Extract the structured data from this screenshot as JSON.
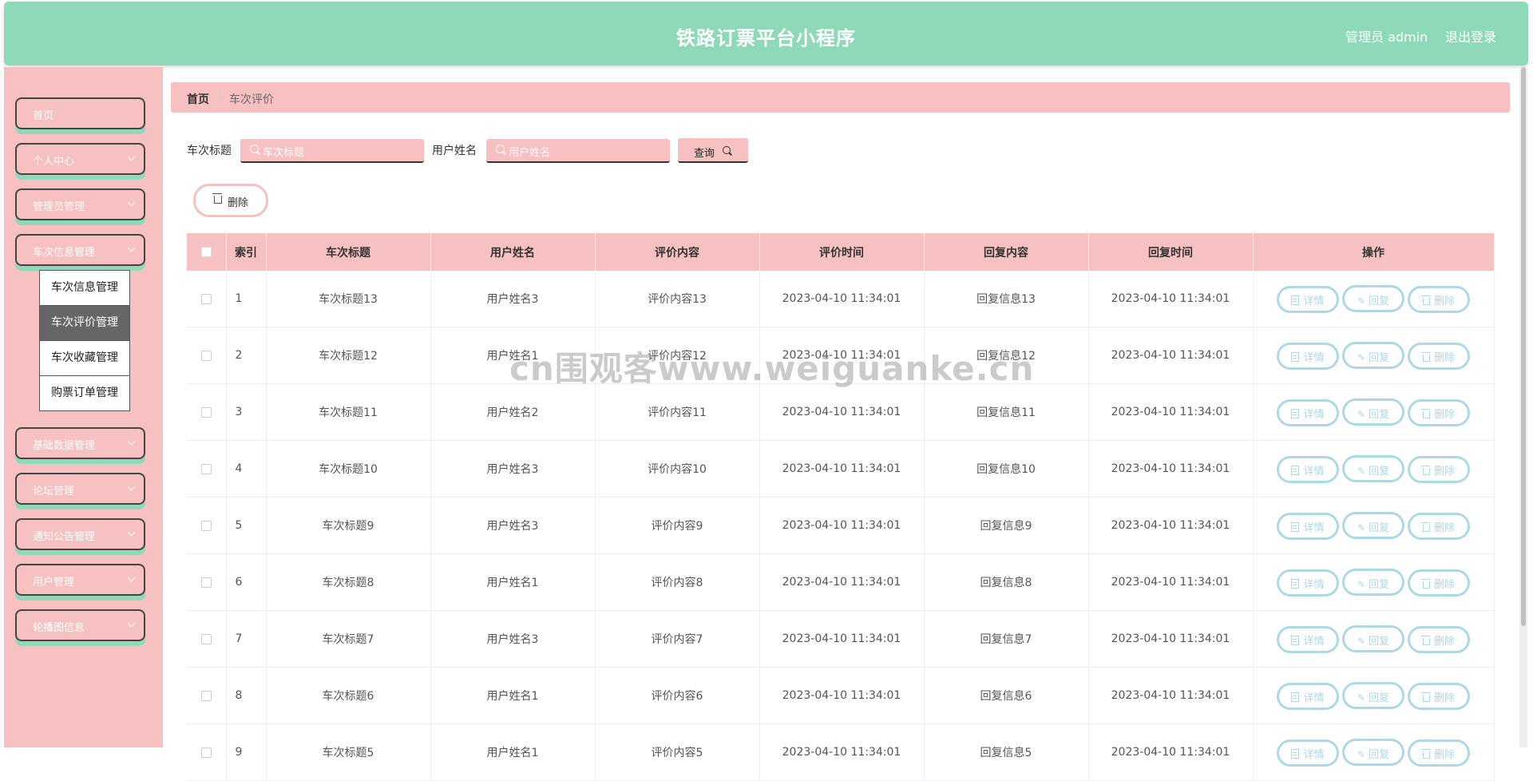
{
  "header": {
    "title": "铁路订票平台小程序",
    "admin_label": "管理员 admin",
    "logout_label": "退出登录"
  },
  "sidebar": {
    "items": [
      {
        "label": "首页",
        "has_chevron": false
      },
      {
        "label": "个人中心",
        "has_chevron": true
      },
      {
        "label": "管理员管理",
        "has_chevron": true
      },
      {
        "label": "车次信息管理",
        "has_chevron": true
      },
      {
        "label": "基础数据管理",
        "has_chevron": true
      },
      {
        "label": "论坛管理",
        "has_chevron": true
      },
      {
        "label": "通知公告管理",
        "has_chevron": true
      },
      {
        "label": "用户管理",
        "has_chevron": true
      },
      {
        "label": "轮播图信息",
        "has_chevron": true
      }
    ],
    "submenu": [
      "车次信息管理",
      "车次评价管理",
      "车次收藏管理",
      "购票订单管理"
    ],
    "active_submenu": "车次评价管理"
  },
  "breadcrumb": {
    "home": "首页",
    "separator": "/",
    "current": "车次评价"
  },
  "search": {
    "title_label": "车次标题",
    "title_placeholder": "车次标题",
    "user_label": "用户姓名",
    "user_placeholder": "用户姓名",
    "query_label": "查询"
  },
  "toolbar": {
    "delete_label": "删除"
  },
  "table": {
    "columns": [
      "索引",
      "车次标题",
      "用户姓名",
      "评价内容",
      "评价时间",
      "回复内容",
      "回复时间",
      "操作"
    ],
    "actions": [
      "详情",
      "回复",
      "删除"
    ],
    "rows": [
      [
        "1",
        "车次标题13",
        "用户姓名3",
        "评价内容13",
        "2023-04-10 11:34:01",
        "回复信息13",
        "2023-04-10 11:34:01"
      ],
      [
        "2",
        "车次标题12",
        "用户姓名1",
        "评价内容12",
        "2023-04-10 11:34:01",
        "回复信息12",
        "2023-04-10 11:34:01"
      ],
      [
        "3",
        "车次标题11",
        "用户姓名2",
        "评价内容11",
        "2023-04-10 11:34:01",
        "回复信息11",
        "2023-04-10 11:34:01"
      ],
      [
        "4",
        "车次标题10",
        "用户姓名3",
        "评价内容10",
        "2023-04-10 11:34:01",
        "回复信息10",
        "2023-04-10 11:34:01"
      ],
      [
        "5",
        "车次标题9",
        "用户姓名3",
        "评价内容9",
        "2023-04-10 11:34:01",
        "回复信息9",
        "2023-04-10 11:34:01"
      ],
      [
        "6",
        "车次标题8",
        "用户姓名1",
        "评价内容8",
        "2023-04-10 11:34:01",
        "回复信息8",
        "2023-04-10 11:34:01"
      ],
      [
        "7",
        "车次标题7",
        "用户姓名3",
        "评价内容7",
        "2023-04-10 11:34:01",
        "回复信息7",
        "2023-04-10 11:34:01"
      ],
      [
        "8",
        "车次标题6",
        "用户姓名1",
        "评价内容6",
        "2023-04-10 11:34:01",
        "回复信息6",
        "2023-04-10 11:34:01"
      ],
      [
        "9",
        "车次标题5",
        "用户姓名1",
        "评价内容5",
        "2023-04-10 11:34:01",
        "回复信息5",
        "2023-04-10 11:34:01"
      ]
    ]
  },
  "watermark": "cn围观客www.weiguanke.cn",
  "colors": {
    "header_bg": "#8ed9b8",
    "accent_pink": "#f7c1c1",
    "action_blue": "#add8e6"
  }
}
